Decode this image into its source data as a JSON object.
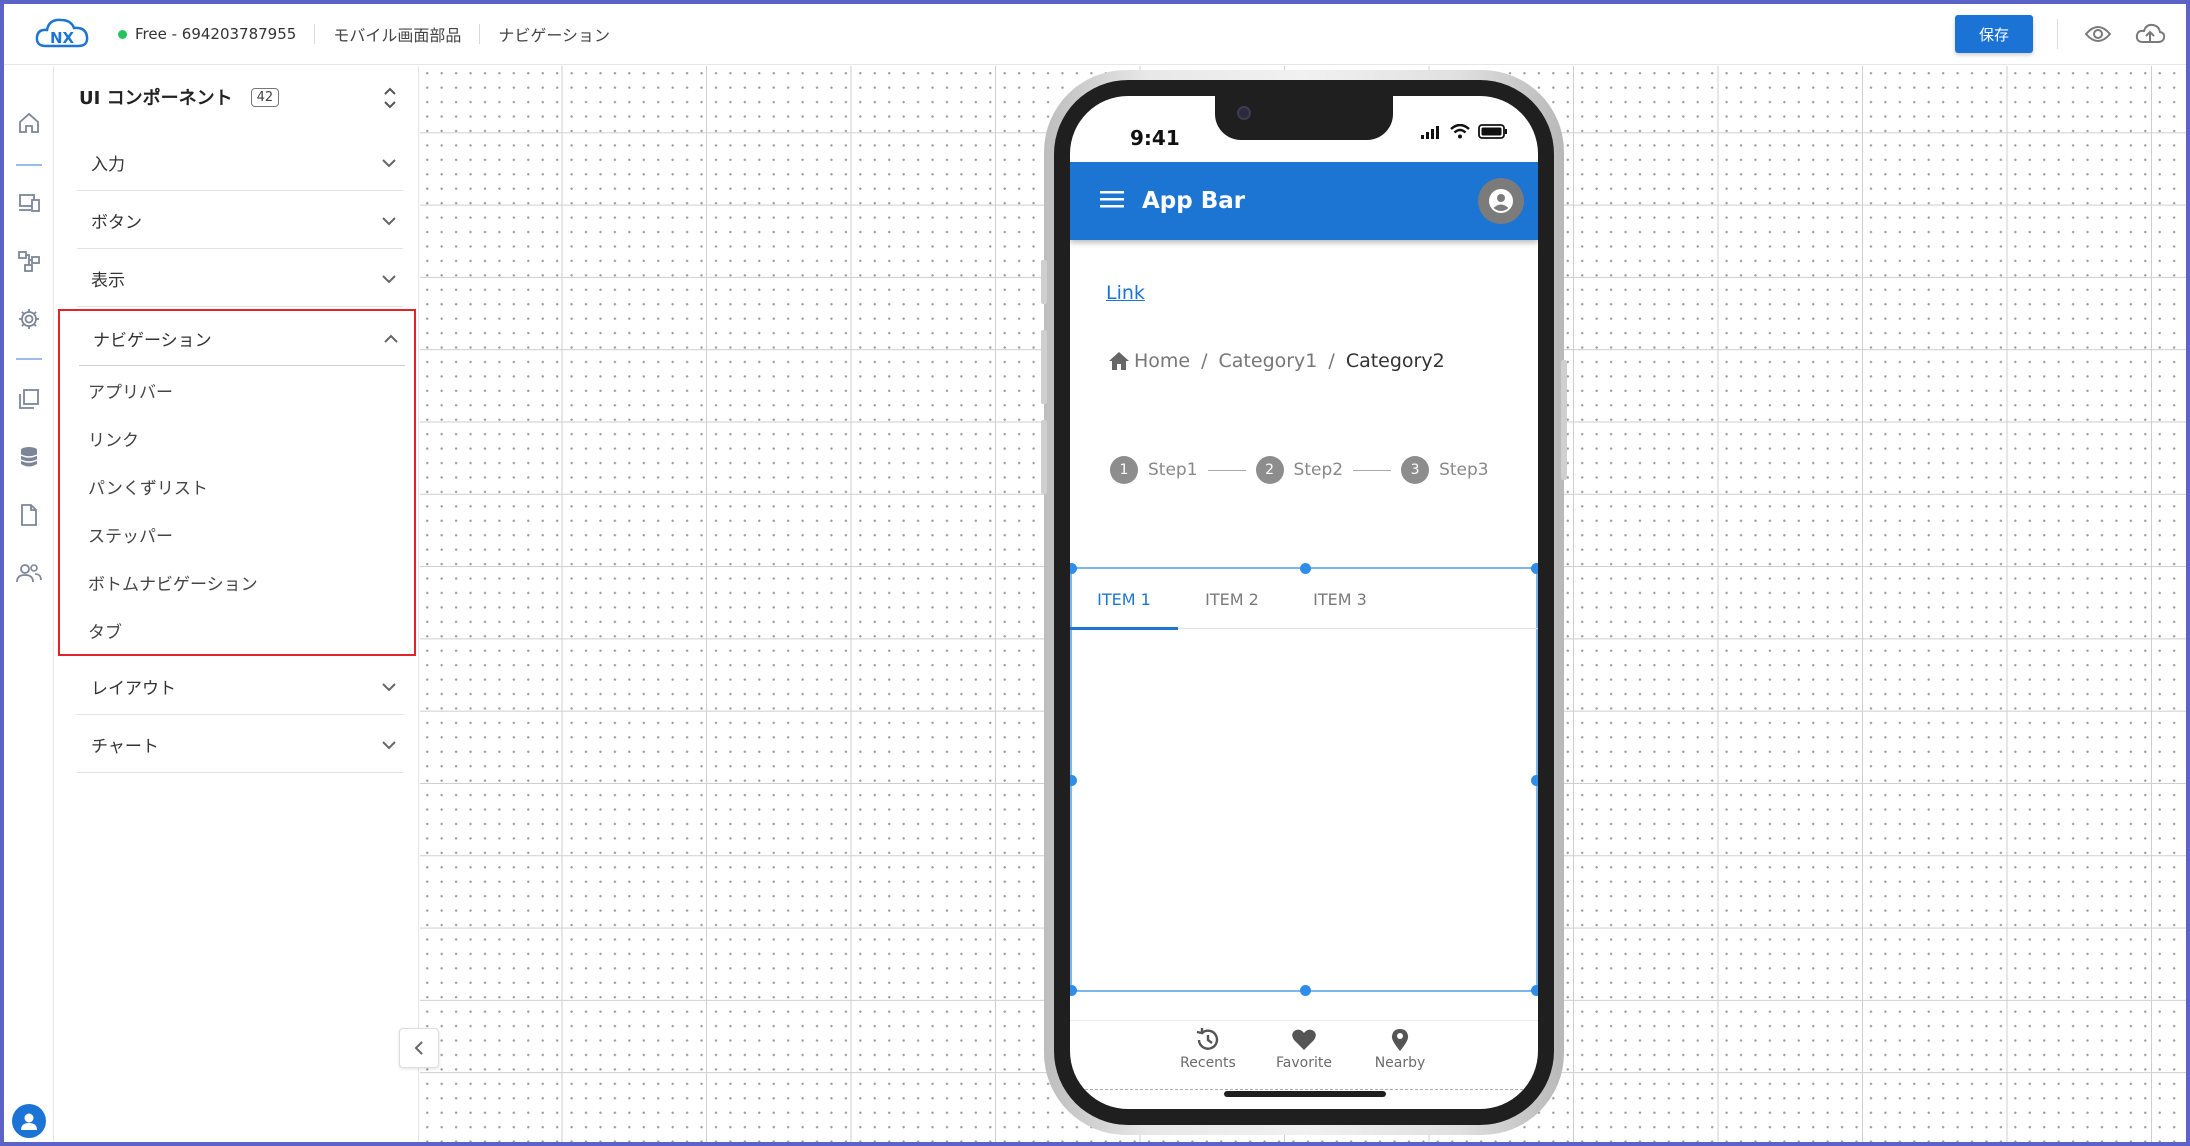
{
  "header": {
    "plan_label": "Free - 694203787955",
    "breadcrumb_1": "モバイル画面部品",
    "breadcrumb_2": "ナビゲーション",
    "save_label": "保存"
  },
  "panel": {
    "title": "UI コンポーネント",
    "count": "42",
    "sections": [
      {
        "label": "入力"
      },
      {
        "label": "ボタン"
      },
      {
        "label": "表示"
      },
      {
        "label": "ナビゲーション"
      },
      {
        "label": "レイアウト"
      },
      {
        "label": "チャート"
      }
    ],
    "nav_items": [
      {
        "label": "アプリバー"
      },
      {
        "label": "リンク"
      },
      {
        "label": "パンくずリスト"
      },
      {
        "label": "ステッパー"
      },
      {
        "label": "ボトムナビゲーション"
      },
      {
        "label": "タブ"
      }
    ]
  },
  "phone": {
    "time": "9:41",
    "appbar_title": "App Bar",
    "link_text": "Link",
    "breadcrumb": {
      "home": "Home",
      "cat1": "Category1",
      "cat2": "Category2",
      "separator": "/"
    },
    "steps": [
      {
        "num": "1",
        "label": "Step1"
      },
      {
        "num": "2",
        "label": "Step2"
      },
      {
        "num": "3",
        "label": "Step3"
      }
    ],
    "tabs": [
      {
        "label": "ITEM 1"
      },
      {
        "label": "ITEM 2"
      },
      {
        "label": "ITEM 3"
      }
    ],
    "active_tab": 0,
    "bottom_nav": [
      {
        "label": "Recents",
        "icon": "history-icon"
      },
      {
        "label": "Favorite",
        "icon": "heart-icon"
      },
      {
        "label": "Nearby",
        "icon": "location-pin-icon"
      }
    ]
  },
  "colors": {
    "primary": "#1c75d3",
    "highlight_border": "#e0242a",
    "status_green": "#25c35d",
    "frame_border": "#5b63c8"
  }
}
